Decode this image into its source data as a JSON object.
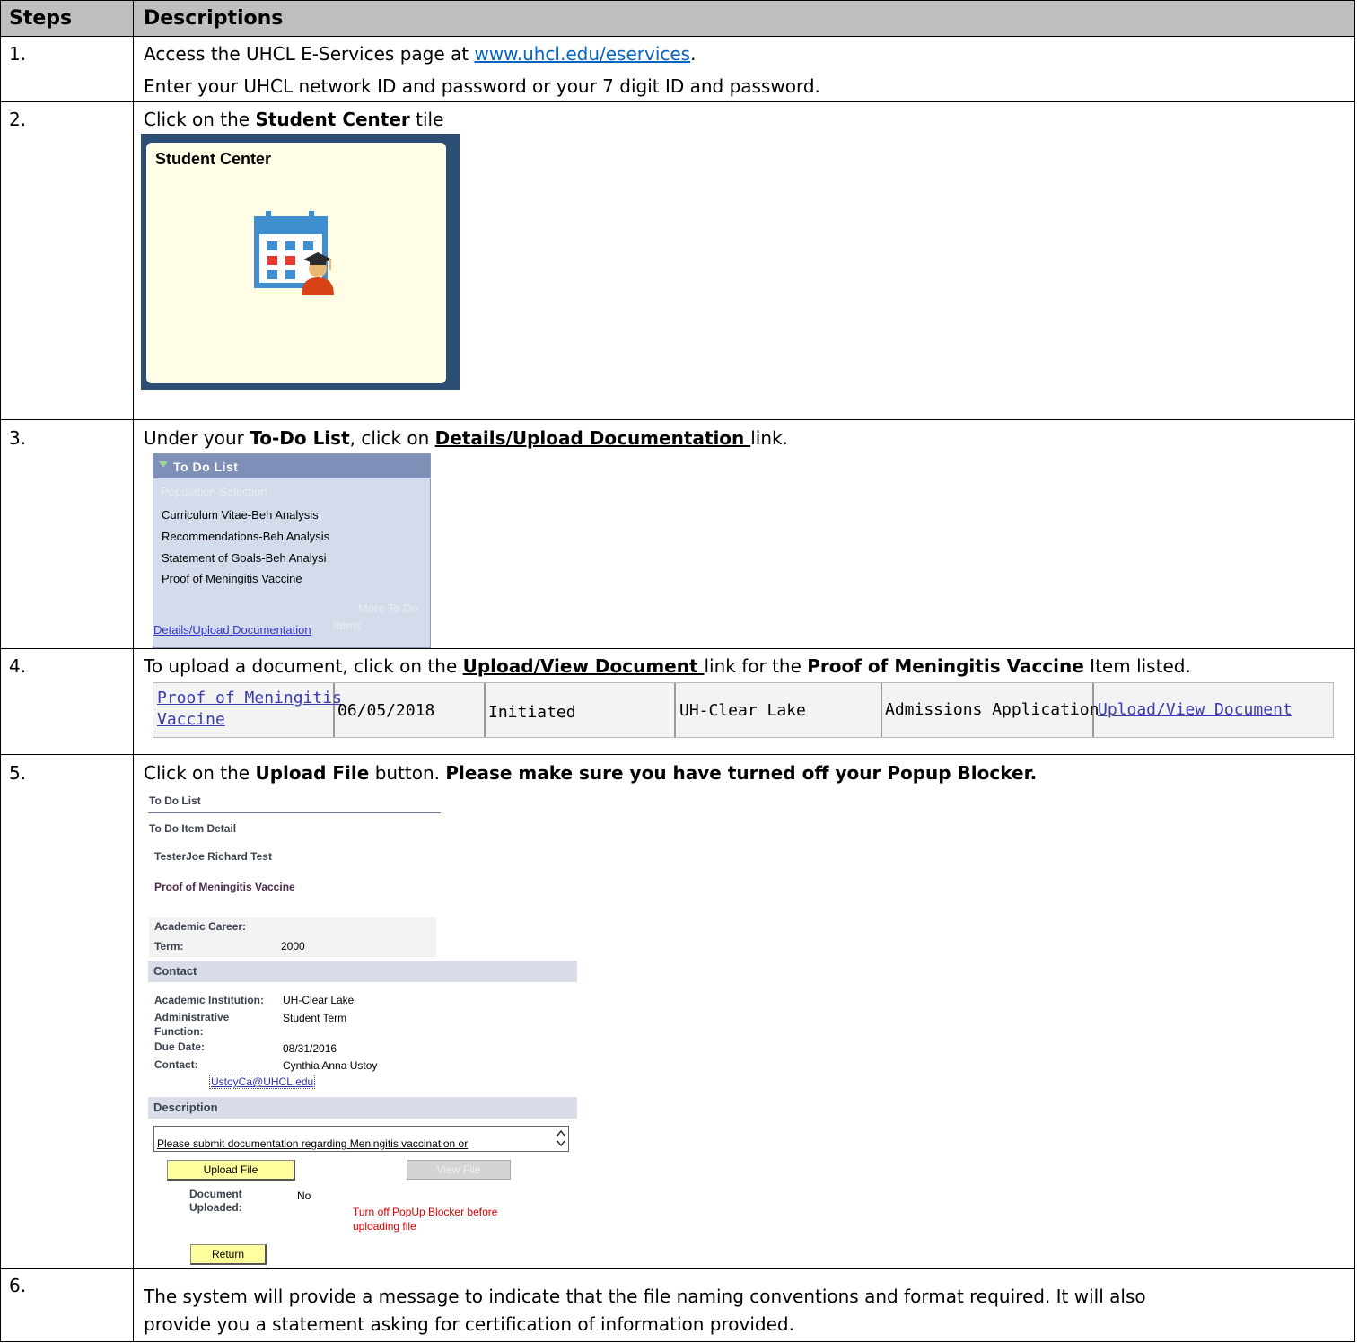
{
  "headers": {
    "steps": "Steps",
    "descriptions": "Descriptions"
  },
  "step1": {
    "num": "1.",
    "line1_prefix": "Access the UHCL E-Services page at ",
    "link": "www.uhcl.edu/eservices",
    "line1_suffix": ".",
    "line2": "Enter your UHCL network ID and password or your 7 digit ID and password."
  },
  "step2": {
    "num": "2.",
    "prefix": "Click on the ",
    "bold": "Student Center",
    "suffix": " tile",
    "tile_title": "Student Center"
  },
  "step3": {
    "num": "3.",
    "prefix": "Under your ",
    "bold1": "To-Do List",
    "mid": ", click on ",
    "bold2": "Details/Upload Documentation ",
    "suffix": "link.",
    "panel_title": "To Do List",
    "population_selection": "Population  Selection",
    "items": [
      "Curriculum  Vitae-Beh  Analysis",
      "Recommendations-Beh  Analysis",
      "Statement  of  Goals-Beh  Analysi",
      "Proof  of  Meningitis  Vaccine"
    ],
    "more_line1": "More  To  Do",
    "more_line2": "Items",
    "details_link": "Details/Upload  Documentation"
  },
  "step4": {
    "num": "4.",
    "prefix": "To upload a document, click on the ",
    "bold1": "Upload/View Document ",
    "mid": "link for the ",
    "bold2": "Proof of Meningitis Vaccine",
    "suffix": " Item listed.",
    "row": {
      "item_line1": "Proof of Meningitis",
      "item_line2": "Vaccine",
      "date": "06/05/2018",
      "status": "Initiated",
      "institution": "UH-Clear Lake",
      "function": "Admissions Application",
      "action": "Upload/View Document"
    }
  },
  "step5": {
    "num": "5.",
    "prefix": "Click on the ",
    "bold1": "Upload File",
    "mid": " button.  ",
    "bold2": "Please make sure you have turned off your Popup Blocker.",
    "detail": {
      "todo_list": "To Do List",
      "todo_item_detail": "To Do Item Detail",
      "student": "TesterJoe Richard Test",
      "item": "Proof of Meningitis Vaccine",
      "academic_career_label": "Academic Career:",
      "term_label": "Term:",
      "term_value": "2000",
      "contact_section": "Contact",
      "academic_institution_label": "Academic Institution:",
      "academic_institution_value": "UH-Clear  Lake",
      "admin_function_label1": "Administrative",
      "admin_function_label2": "Function:",
      "admin_function_value": "Student  Term",
      "due_date_label": "Due Date:",
      "due_date_value": "08/31/2016",
      "contact_label": "Contact:",
      "contact_value": "Cynthia  Anna  Ustoy",
      "contact_email": "UstoyCa@UHCL.edu",
      "description_section": "Description",
      "description_text": "Please  submit  documentation  regarding  Meningitis  vaccination  or",
      "upload_button": "Upload File",
      "view_button": "View File",
      "doc_uploaded_label1": "Document",
      "doc_uploaded_label2": "Uploaded:",
      "doc_uploaded_value": "No",
      "popup_warning1": "Turn  off  PopUp  Blocker  before",
      "popup_warning2": "uploading  file",
      "return_button": "Return"
    }
  },
  "step6": {
    "num": "6.",
    "line1": "The system will provide a message to indicate that the file naming conventions and format required.  It will also",
    "line2": "provide you a statement asking for certification of information provided."
  },
  "colors": {
    "header_bg": "#bfbfbf",
    "link": "#0563c1",
    "tile_frame": "#2d4e74",
    "tile_bg": "#fffde6",
    "todo_bg": "#d4dbea",
    "todo_header": "#7e8fb8",
    "warning_red": "#e00000",
    "button_yellow": "#ffff9e"
  },
  "icons": [
    "calendar-graduate-icon",
    "collapse-triangle-icon",
    "scroll-arrows-icon"
  ]
}
